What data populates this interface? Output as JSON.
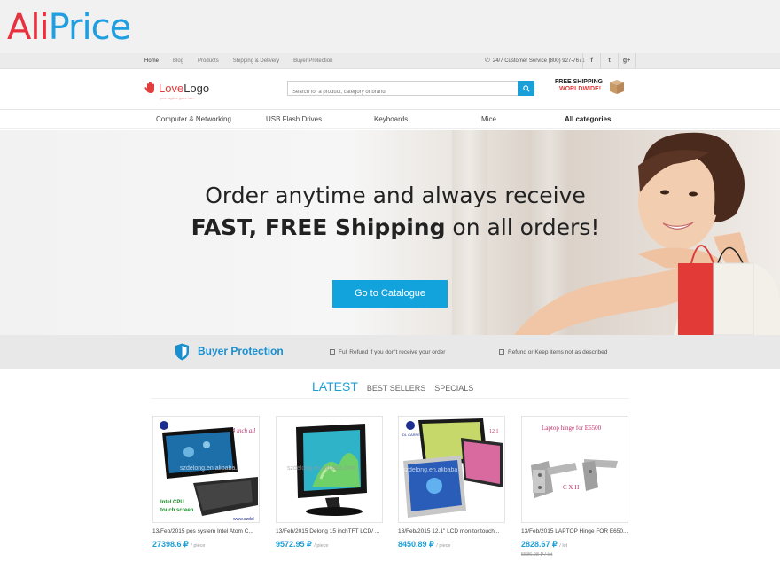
{
  "aliprice": {
    "part1": "Ali",
    "part2": "Price"
  },
  "topnav": {
    "links": [
      "Home",
      "Blog",
      "Products",
      "Shipping & Delivery",
      "Buyer Protection"
    ],
    "support": "24/7 Customer Service (800) 927-7671",
    "social": [
      "f",
      "t",
      "g+"
    ]
  },
  "logo": {
    "part1": "Love",
    "part2": "Logo",
    "tagline": "your tagline goes here"
  },
  "search": {
    "placeholder": "Search for a product, category or brand"
  },
  "shipping_badge": {
    "line1": "FREE SHIPPING",
    "line2": "WORLDWIDE!"
  },
  "categories": [
    "Computer & Networking",
    "USB Flash Drives",
    "Keyboards",
    "Mice",
    "All categories"
  ],
  "hero": {
    "line1": "Order anytime and always receive",
    "line2_bold": "FAST, FREE Shipping",
    "line2_rest": " on all orders!",
    "cta": "Go to Catalogue"
  },
  "protection": {
    "title": "Buyer Protection",
    "items": [
      "Full Refund if you don't receive your order",
      "Refund or Keep items not as described"
    ]
  },
  "tabs": [
    "LATEST",
    "BEST SELLERS",
    "SPECIALS"
  ],
  "products": [
    {
      "title": "13/Feb/2015 pos system Intel Atom C...",
      "price": "27398.6 ₽",
      "unit": "/ piece",
      "old": ""
    },
    {
      "title": "13/Feb/2015 Delong 15 inchTFT LCD/ ...",
      "price": "9572.95 ₽",
      "unit": "/ piece",
      "old": ""
    },
    {
      "title": "13/Feb/2015 12.1\" LCD monitor,touch...",
      "price": "8450.89 ₽",
      "unit": "/ piece",
      "old": ""
    },
    {
      "title": "13/Feb/2015 LAPTOP Hinge FOR E650...",
      "price": "2828.67 ₽",
      "unit": "/ lot",
      "old": "5586.98 ₽ / lot"
    }
  ],
  "product_images": {
    "p1": {
      "headline": "15.4 inch all",
      "brand_text": "szdelong.en.alibaba.co",
      "caption1": "Intel CPU",
      "caption2": "touch screen",
      "footer": "www.szdel"
    },
    "p2": {
      "brand_text": "szdelong.en.alibaba.com"
    },
    "p3": {
      "logo_text": "DL CARPE",
      "headline": "12.1",
      "brand_text": "szdelong.en.alibaba"
    },
    "p4": {
      "headline": "Laptop hinge for E6500",
      "caption": "C X H"
    }
  },
  "colors": {
    "accent": "#1a9fd8",
    "brand_red": "#e8303f",
    "brand_blue": "#1f9ee0"
  }
}
